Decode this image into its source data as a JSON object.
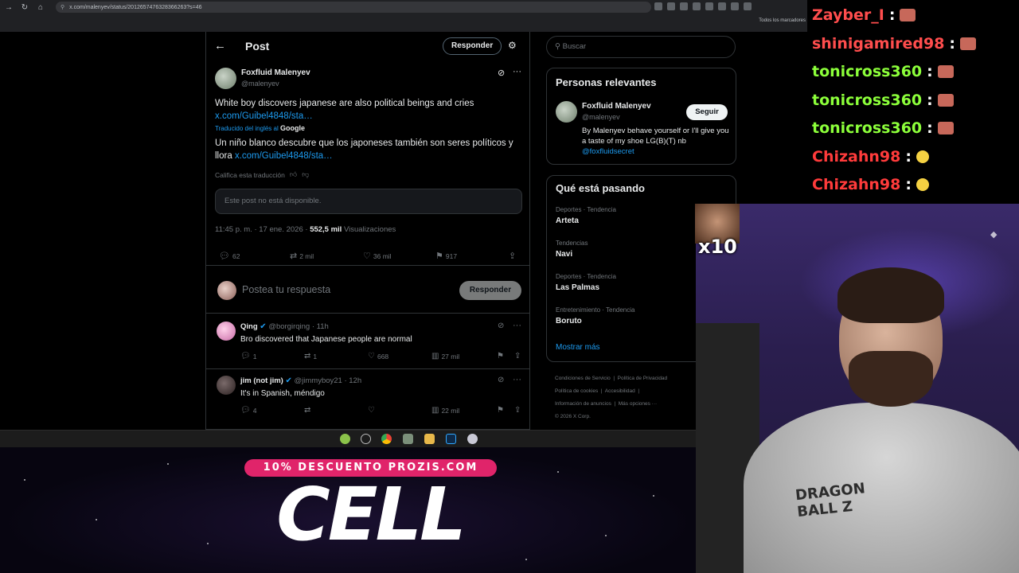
{
  "browser": {
    "url": "x.com/malenyev/status/2012657476328366263?s=46",
    "bookmarks_all": "Todos los marcadores"
  },
  "post_header": {
    "title": "Post",
    "reply_button": "Responder"
  },
  "post": {
    "author_name": "Foxfluid Malenyev",
    "author_handle": "@malenyev",
    "text_en": "White boy discovers japanese are also political beings and cries",
    "link1": "x.com/Guibel4848/sta…",
    "translated_by": "Traducido del inglés al",
    "translator": "Google",
    "text_es": "Un niño blanco descubre que los japoneses también son seres políticos y llora",
    "link2": "x.com/Guibel4848/sta…",
    "rate_translation": "Califica esta traducción",
    "unavailable": "Este post no está disponible.",
    "timestamp": "11:45 p. m. · 17 ene. 2026 ·",
    "views_count": "552,5 mil",
    "views_label": "Visualizaciones",
    "replies": "62",
    "reposts": "2 mil",
    "likes": "36 mil",
    "bookmarks": "917"
  },
  "compose": {
    "placeholder": "Postea tu respuesta",
    "button": "Responder"
  },
  "replies": [
    {
      "name": "Qing",
      "handle": "@borgirqing",
      "time": "· 11h",
      "text": "Bro discovered that Japanese people are normal",
      "replies": "1",
      "reposts": "1",
      "likes": "668",
      "views": "27 mil"
    },
    {
      "name": "jim (not jim)",
      "handle": "@jimmyboy21",
      "time": "· 12h",
      "text": "It's in Spanish, méndigo",
      "replies": "4",
      "reposts": "",
      "likes": "",
      "views": "22 mil"
    }
  ],
  "sidebar": {
    "search_placeholder": "Buscar",
    "relevant_title": "Personas relevantes",
    "relevant_name": "Foxfluid Malenyev",
    "relevant_handle": "@malenyev",
    "follow_button": "Seguir",
    "relevant_bio": "By Malenyev behave yourself or I'll give you a taste of my shoe LG(B)(T) nb",
    "relevant_bio_link": "@foxfluidsecret",
    "trends_title": "Qué está pasando",
    "trends": [
      {
        "meta": "Deportes · Tendencia",
        "name": "Arteta"
      },
      {
        "meta": "Tendencias",
        "name": "Navi"
      },
      {
        "meta": "Deportes · Tendencia",
        "name": "Las Palmas"
      },
      {
        "meta": "Entretenimiento · Tendencia",
        "name": "Boruto"
      }
    ],
    "show_more": "Mostrar más",
    "footer": {
      "terms": "Condiciones de Servicio",
      "privacy": "Política de Privacidad",
      "cookies": "Política de cookies",
      "accessibility": "Accesibilidad",
      "ads": "Información de anuncios",
      "more": "Más opciones ···",
      "copyright": "© 2026 X Corp."
    }
  },
  "chat": [
    {
      "user": "Zayber_I",
      "color": "#ff4d4d"
    },
    {
      "user": "shinigamired98",
      "color": "#ff4d4d"
    },
    {
      "user": "tonicross360",
      "color": "#8cff3a"
    },
    {
      "user": "tonicross360",
      "color": "#8cff3a"
    },
    {
      "user": "tonicross360",
      "color": "#8cff3a"
    },
    {
      "user": "Chizahn98",
      "color": "#ff3b3b"
    },
    {
      "user": "Chizahn98",
      "color": "#ff3b3b"
    }
  ],
  "overlay": {
    "promo": "10% DESCUENTO PROZIS.COM",
    "code": "CELL",
    "emote_multiplier": "x10",
    "shirt_print": "DRAGON BALL Z"
  }
}
